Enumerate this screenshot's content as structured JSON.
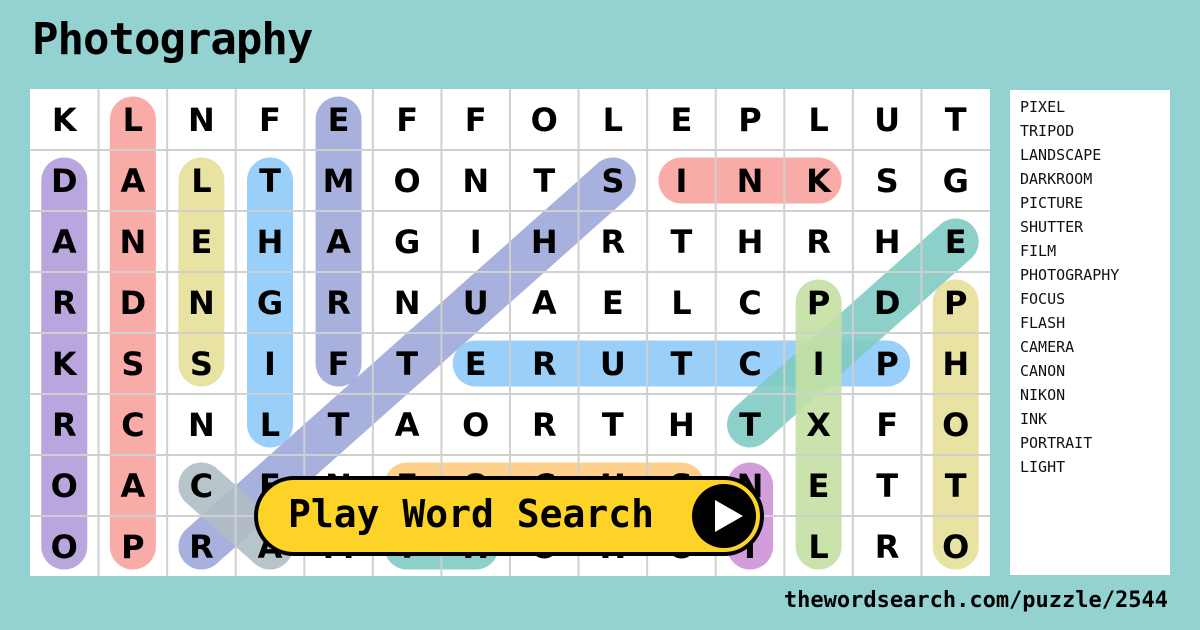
{
  "title": "Photography",
  "grid": {
    "rows": [
      [
        "K",
        "L",
        "N",
        "F",
        "E",
        "F",
        "F",
        "O",
        "L",
        "E",
        "P",
        "L",
        "U",
        "T"
      ],
      [
        "D",
        "A",
        "L",
        "T",
        "M",
        "O",
        "N",
        "T",
        "S",
        "I",
        "N",
        "K",
        "S",
        "G"
      ],
      [
        "A",
        "N",
        "E",
        "H",
        "A",
        "G",
        "I",
        "H",
        "R",
        "T",
        "H",
        "R",
        "H",
        "E"
      ],
      [
        "R",
        "D",
        "N",
        "G",
        "R",
        "N",
        "U",
        "A",
        "E",
        "L",
        "C",
        "P",
        "D",
        "P"
      ],
      [
        "K",
        "S",
        "S",
        "I",
        "F",
        "T",
        "E",
        "R",
        "U",
        "T",
        "C",
        "I",
        "P",
        "H"
      ],
      [
        "R",
        "C",
        "N",
        "L",
        "T",
        "A",
        "O",
        "R",
        "T",
        "H",
        "T",
        "X",
        "F",
        "O"
      ],
      [
        "O",
        "A",
        "C",
        "E",
        "N",
        "F",
        "O",
        "C",
        "U",
        "S",
        "N",
        "E",
        "T",
        "T"
      ],
      [
        "O",
        "P",
        "R",
        "A",
        "M",
        "T",
        "H",
        "O",
        "H",
        "O",
        "I",
        "L",
        "R",
        "O"
      ]
    ],
    "found_words": [
      {
        "word": "DARKROOM",
        "from": [
          1,
          0
        ],
        "to": [
          7,
          0
        ],
        "color": "#b39ddb"
      },
      {
        "word": "LANDSCAPE",
        "from": [
          0,
          1
        ],
        "to": [
          7,
          1
        ],
        "color": "#f8a29e"
      },
      {
        "word": "LENS",
        "from": [
          1,
          2
        ],
        "to": [
          4,
          2
        ],
        "color": "#e6df9a"
      },
      {
        "word": "LIGHT",
        "from": [
          5,
          3
        ],
        "to": [
          1,
          3
        ],
        "color": "#90caf9"
      },
      {
        "word": "FRAME",
        "from": [
          4,
          4
        ],
        "to": [
          0,
          4
        ],
        "color": "#9fa8da"
      },
      {
        "word": "SHUTTER",
        "from": [
          1,
          8
        ],
        "to": [
          7,
          2
        ],
        "color": "#9fa8da"
      },
      {
        "word": "INK",
        "from": [
          1,
          9
        ],
        "to": [
          1,
          11
        ],
        "color": "#f8a29e"
      },
      {
        "word": "PICTURE",
        "from": [
          4,
          12
        ],
        "to": [
          4,
          6
        ],
        "color": "#90caf9"
      },
      {
        "word": "TRIPOD",
        "from": [
          5,
          10
        ],
        "to": [
          2,
          13
        ],
        "color": "#80cbc4"
      },
      {
        "word": "PIXEL",
        "from": [
          3,
          11
        ],
        "to": [
          7,
          11
        ],
        "color": "#c5e1a5"
      },
      {
        "word": "PHOTO",
        "from": [
          3,
          13
        ],
        "to": [
          7,
          13
        ],
        "color": "#e6df9a"
      },
      {
        "word": "FOCUS",
        "from": [
          6,
          5
        ],
        "to": [
          6,
          9
        ],
        "color": "#ffcc80"
      },
      {
        "word": "NIKON",
        "from": [
          6,
          10
        ],
        "to": [
          7,
          10
        ],
        "color": "#ce93d8"
      },
      {
        "word": "CAMERA",
        "from": [
          6,
          2
        ],
        "to": [
          7,
          3
        ],
        "color": "#b0bec5"
      },
      {
        "word": "FLASH",
        "from": [
          7,
          5
        ],
        "to": [
          7,
          6
        ],
        "color": "#80cbc4"
      }
    ]
  },
  "word_list": [
    "PIXEL",
    "TRIPOD",
    "LANDSCAPE",
    "DARKROOM",
    "PICTURE",
    "SHUTTER",
    "FILM",
    "PHOTOGRAPHY",
    "FOCUS",
    "FLASH",
    "CAMERA",
    "CANON",
    "NIKON",
    "INK",
    "PORTRAIT",
    "LIGHT"
  ],
  "play_button": {
    "label": "Play Word Search",
    "icon": "play-icon",
    "color": "#fdd327"
  },
  "footer": {
    "url": "thewordsearch.com/puzzle/2544"
  },
  "colors": {
    "background": "#94d2d2"
  }
}
